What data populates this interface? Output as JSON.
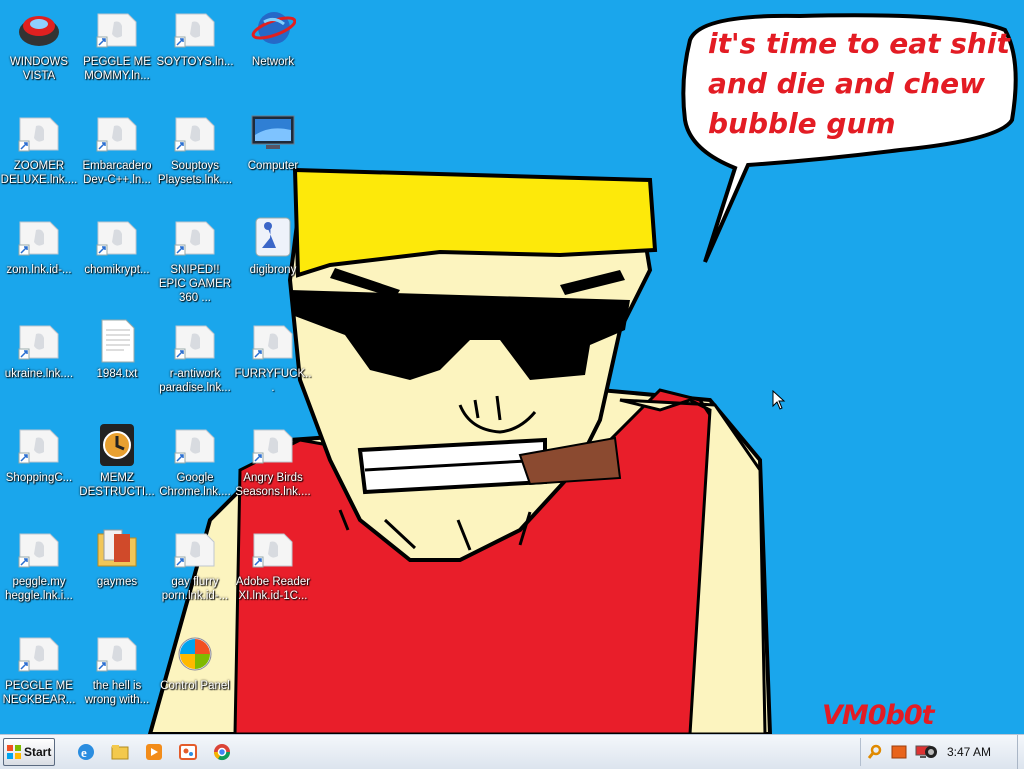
{
  "wallpaper": {
    "speech_lines": [
      "it's time to eat shit",
      "and die and chew",
      "bubble gum"
    ],
    "signature": "VM0b0t"
  },
  "desktop_icons": [
    {
      "label": "WINDOWS VISTA",
      "icon": "vista-icon"
    },
    {
      "label": "PEGGLE ME MOMMY.ln...",
      "icon": "shortcut-icon"
    },
    {
      "label": "SOYTOYS.ln...",
      "icon": "shortcut-icon"
    },
    {
      "label": "Network",
      "icon": "network-icon"
    },
    {
      "label": "ZOOMER DELUXE.lnk....",
      "icon": "shortcut-icon"
    },
    {
      "label": "Embarcadero Dev-C++.ln...",
      "icon": "shortcut-icon"
    },
    {
      "label": "Souptoys Playsets.lnk....",
      "icon": "shortcut-icon"
    },
    {
      "label": "Computer",
      "icon": "computer-icon"
    },
    {
      "label": "zom.lnk.id-...",
      "icon": "shortcut-icon"
    },
    {
      "label": "chomikrypt...",
      "icon": "shortcut-icon"
    },
    {
      "label": "SNIPED!! EPIC GAMER 360 ...",
      "icon": "shortcut-icon"
    },
    {
      "label": "digibrony",
      "icon": "digibrony-icon"
    },
    {
      "label": "ukraine.lnk....",
      "icon": "shortcut-icon"
    },
    {
      "label": "1984.txt",
      "icon": "text-file-icon"
    },
    {
      "label": "r-antiwork paradise.lnk...",
      "icon": "shortcut-icon"
    },
    {
      "label": "FURRYFUCK...",
      "icon": "shortcut-icon"
    },
    {
      "label": "ShoppingC...",
      "icon": "shortcut-icon"
    },
    {
      "label": "MEMZ DESTRUCTI...",
      "icon": "memz-icon"
    },
    {
      "label": "Google Chrome.lnk....",
      "icon": "shortcut-icon"
    },
    {
      "label": "Angry Birds Seasons.lnk....",
      "icon": "shortcut-icon"
    },
    {
      "label": "peggle.my heggle.lnk.i...",
      "icon": "shortcut-icon"
    },
    {
      "label": "gaymes",
      "icon": "folder-icon"
    },
    {
      "label": "gay flurry porn.lnk.id-...",
      "icon": "shortcut-icon"
    },
    {
      "label": "Adobe Reader XI.lnk.id-1C...",
      "icon": "shortcut-icon"
    },
    {
      "label": "PEGGLE ME NECKBEAR...",
      "icon": "shortcut-icon"
    },
    {
      "label": "the hell is wrong with...",
      "icon": "shortcut-icon"
    },
    {
      "label": "Control Panel",
      "icon": "control-panel-icon"
    }
  ],
  "taskbar": {
    "start_label": "Start",
    "quick_launch": [
      "ie-icon",
      "explorer-icon",
      "media-player-icon",
      "paint-icon",
      "chrome-icon"
    ],
    "tray_icons": [
      "search-icon",
      "orange-app-icon",
      "display-icon",
      "volume-icon"
    ],
    "clock": "3:47 AM"
  },
  "colors": {
    "desktop_bg": "#1aa6ec",
    "speech_text": "#e31c24",
    "taskbar": "#e8eef5"
  }
}
